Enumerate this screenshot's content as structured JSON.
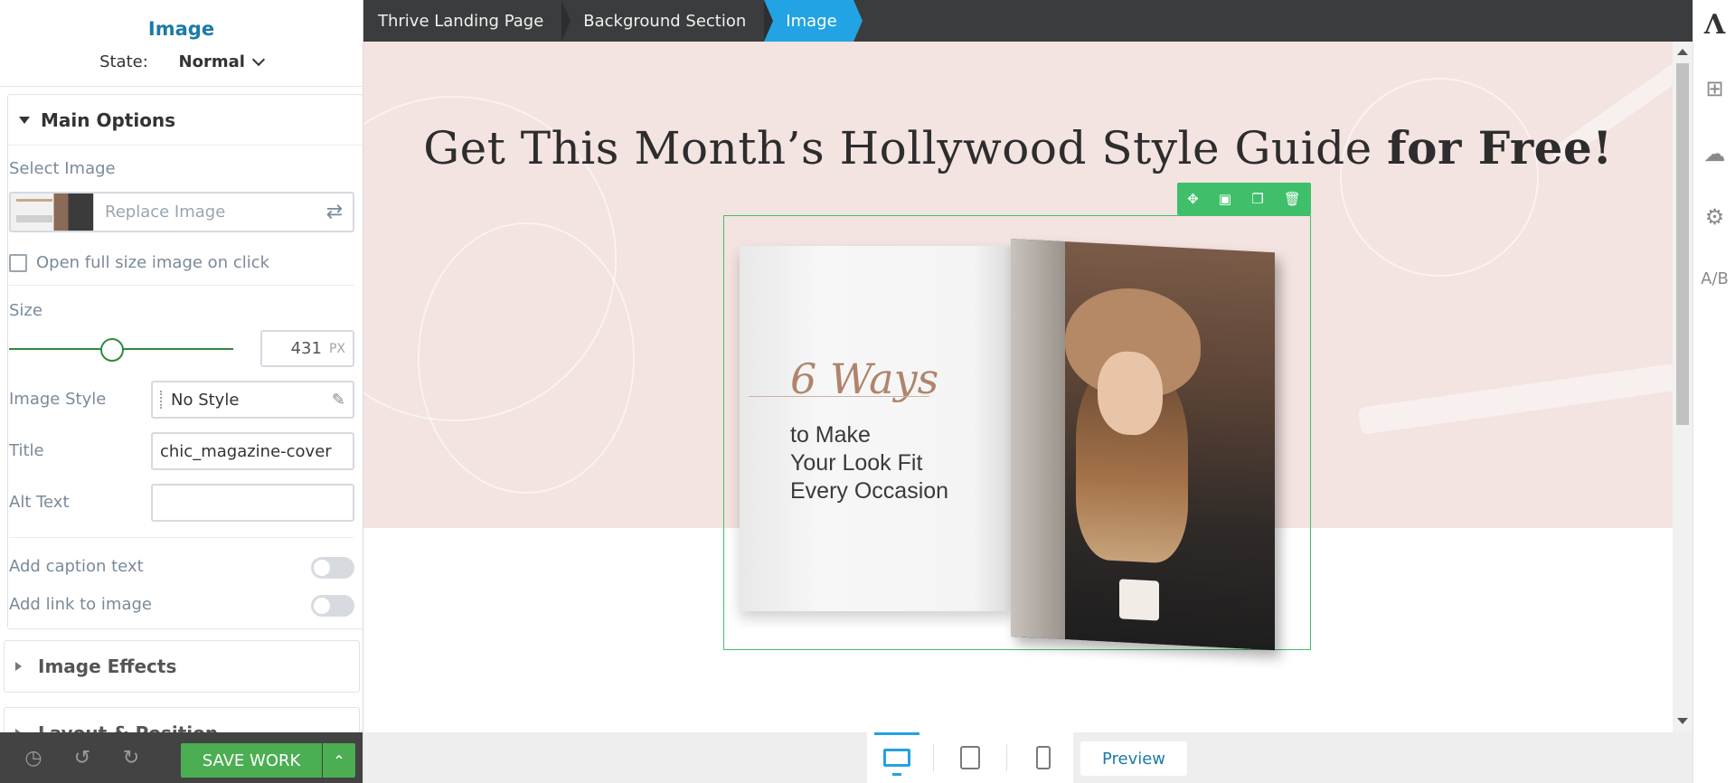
{
  "sidebar": {
    "title": "Image",
    "state_label": "State:",
    "state_value": "Normal",
    "main_options": {
      "title": "Main Options",
      "select_image_label": "Select Image",
      "replace_image_label": "Replace Image",
      "open_full_size_label": "Open full size image on click",
      "open_full_size_checked": false,
      "size_label": "Size",
      "size_value": "431",
      "size_unit": "PX",
      "image_style_label": "Image Style",
      "image_style_value": "No Style",
      "title_label": "Title",
      "title_value": "chic_magazine-cover",
      "alt_text_label": "Alt Text",
      "alt_text_value": "",
      "caption_label": "Add caption text",
      "caption_enabled": false,
      "link_label": "Add link to image",
      "link_enabled": false
    },
    "image_effects_title": "Image Effects",
    "layout_position_title": "Layout & Position",
    "bottom": {
      "save_label": "SAVE WORK",
      "history_icon": "history-icon",
      "undo_icon": "undo-icon",
      "redo_icon": "redo-icon"
    }
  },
  "breadcrumb": [
    {
      "label": "Thrive Landing Page"
    },
    {
      "label": "Background Section"
    },
    {
      "label": "Image",
      "active": true
    }
  ],
  "canvas": {
    "headline_regular": "Get This Month’s Hollywood Style Guide ",
    "headline_bold": "for Free!",
    "magazine_big": "6 Ways",
    "magazine_sub_1": "to Make",
    "magazine_sub_2": "Your Look Fit",
    "magazine_sub_3": "Every Occasion",
    "toolbar_icons": [
      "move-icon",
      "save-template-icon",
      "duplicate-icon",
      "delete-icon"
    ]
  },
  "rail": {
    "icons": [
      "thrive-logo-icon",
      "add-element-icon",
      "cloud-templates-icon",
      "settings-icon",
      "ab-test-icon"
    ],
    "ab_label": "A/B"
  },
  "devicebar": {
    "devices": [
      "desktop-icon",
      "tablet-icon",
      "mobile-icon"
    ],
    "active_device": "desktop",
    "preview_label": "Preview"
  },
  "colors": {
    "accent_blue": "#22a3e3",
    "save_green": "#4bae52",
    "selection_green": "#3fbf6a",
    "hero_pink": "#f3e3e1"
  }
}
